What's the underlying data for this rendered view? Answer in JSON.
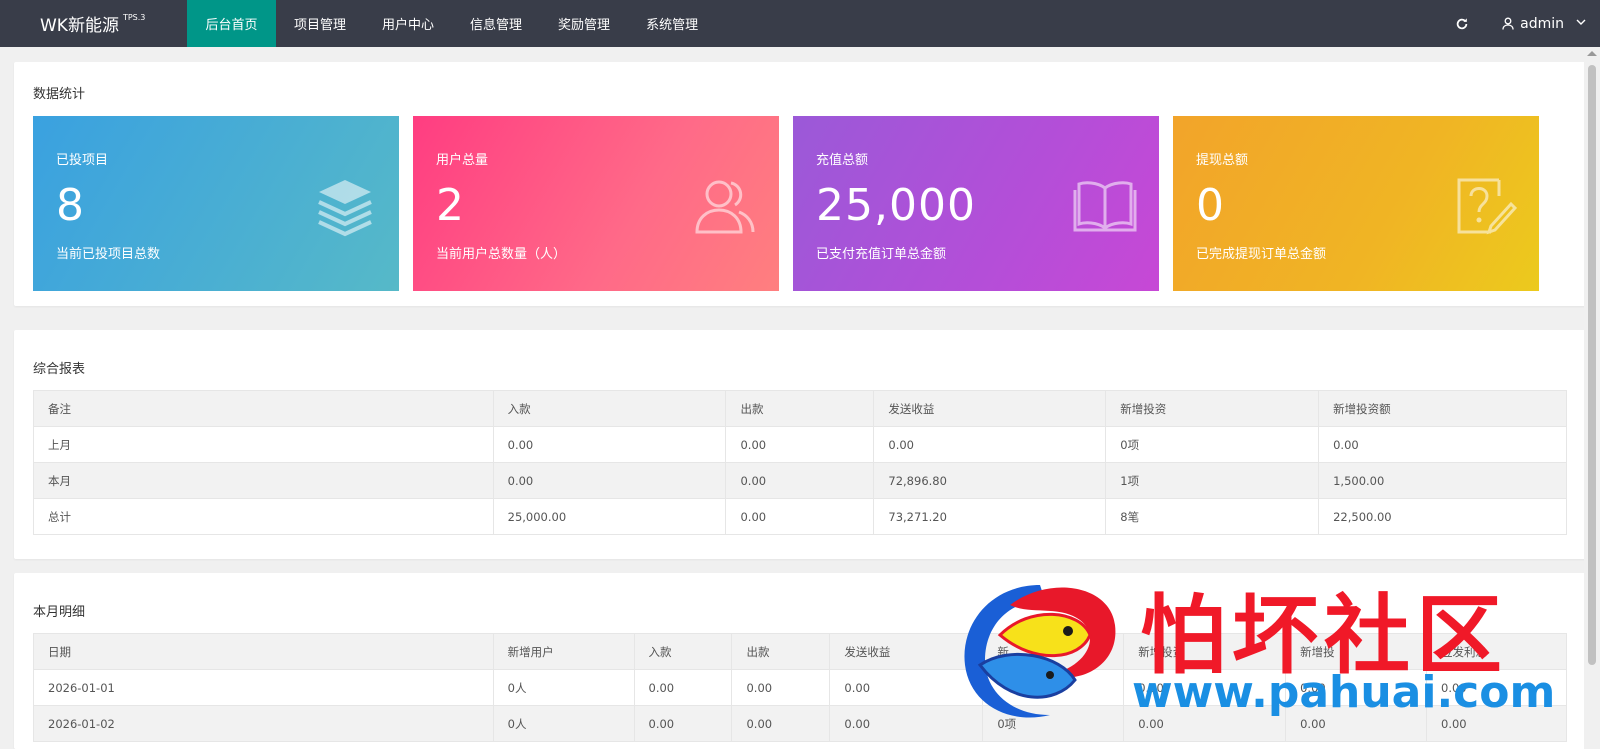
{
  "header": {
    "brand": "WK新能源",
    "brand_sup": "TPS.3",
    "nav": [
      "后台首页",
      "项目管理",
      "用户中心",
      "信息管理",
      "奖励管理",
      "系统管理"
    ],
    "user": "admin",
    "accent": "#009688",
    "bar_color": "#393d49"
  },
  "stats": {
    "title": "数据统计",
    "cards": [
      {
        "title": "已投项目",
        "value": "8",
        "desc": "当前已投项目总数",
        "icon": "layers-icon"
      },
      {
        "title": "用户总量",
        "value": "2",
        "desc": "当前用户总数量（人）",
        "icon": "users-icon"
      },
      {
        "title": "充值总额",
        "value": "25,000",
        "desc": "已支付充值订单总金额",
        "icon": "book-icon"
      },
      {
        "title": "提现总额",
        "value": "0",
        "desc": "已完成提现订单总金额",
        "icon": "question-edit-icon"
      }
    ]
  },
  "report": {
    "title": "综合报表",
    "columns": [
      "备注",
      "入款",
      "出款",
      "发送收益",
      "新增投资",
      "新增投资额"
    ],
    "rows": [
      [
        "上月",
        "0.00",
        "0.00",
        "0.00",
        "0项",
        "0.00"
      ],
      [
        "本月",
        "0.00",
        "0.00",
        "72,896.80",
        "1项",
        "1,500.00"
      ],
      [
        "总计",
        "25,000.00",
        "0.00",
        "73,271.20",
        "8笔",
        "22,500.00"
      ]
    ]
  },
  "monthly": {
    "title": "本月明细",
    "columns": [
      "日期",
      "新增用户",
      "入款",
      "出款",
      "发送收益",
      "新",
      "新增投资",
      "新增投",
      "应发利息"
    ],
    "rows": [
      [
        "2026-01-01",
        "0人",
        "0.00",
        "0.00",
        "0.00",
        "",
        "0.00",
        "0.00",
        "0.00"
      ],
      [
        "2026-01-02",
        "0人",
        "0.00",
        "0.00",
        "0.00",
        "0项",
        "0.00",
        "0.00",
        "0.00"
      ]
    ]
  },
  "watermark": {
    "cn": "怕坏社区",
    "url": "www.pahuai.com"
  }
}
